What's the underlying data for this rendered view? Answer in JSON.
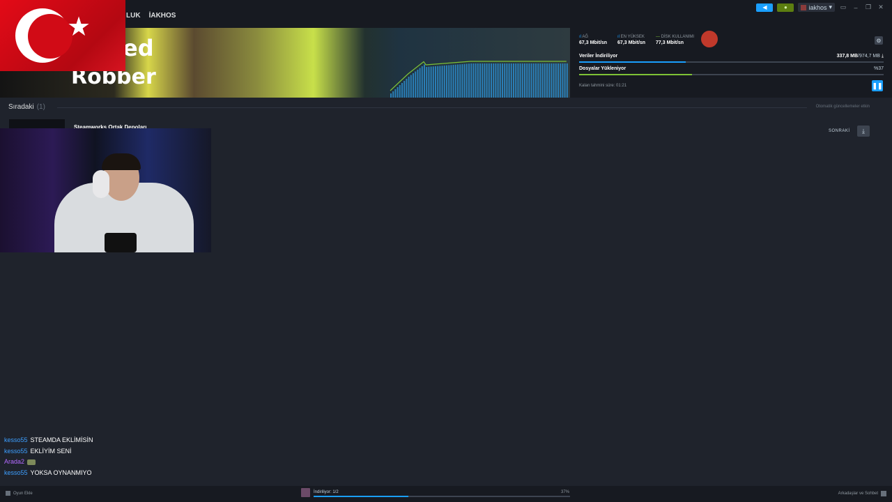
{
  "colors": {
    "accent": "#1a9fff",
    "chart_line": "#7ec236",
    "chart_bar": "#2a7fb8",
    "text_white": "#ffffff"
  },
  "menu": [
    "LUK",
    "İAKHOS"
  ],
  "window": {
    "user_name": "iakhos"
  },
  "banner": {
    "title_top": "ed",
    "title_bottom": "Robber"
  },
  "stats": {
    "network": {
      "label": "AĞ",
      "value": "67,3 Mbit/sn"
    },
    "peak": {
      "label": "EN YÜKSEK",
      "value": "67,3 Mbit/sn"
    },
    "disk": {
      "label": "DİSK KULLANIMI",
      "value": "77,3 Mbit/sn"
    }
  },
  "progress": {
    "downloading_label": "Veriler İndiriliyor",
    "downloaded": "337,8 MB",
    "total": "/974,7 MB",
    "downloading_fraction": 0.35,
    "uploading_label": "Dosyalar Yükleniyor",
    "uploading_percent_text": "%37",
    "uploading_fraction": 0.37,
    "eta": "Kalan tahmini süre: 01:21"
  },
  "queue": {
    "title": "Sıradaki",
    "count": "(1)",
    "auto_updates": "Otomatik güncellemeler etkin",
    "item_title": "Steamworks Ortak Depoları",
    "next_label": "SONRAKİ"
  },
  "chat": [
    {
      "user": "kesso55",
      "color": "#3d9fff",
      "text": "STEAMDA EKLİMİSİN"
    },
    {
      "user": "kesso55",
      "color": "#3d9fff",
      "text": "EKLİYİM SENİ"
    },
    {
      "user": "Arada2",
      "color": "#b36bff",
      "text": ""
    },
    {
      "user": "kesso55",
      "color": "#3d9fff",
      "text": "YOKSA OYNANMIYO"
    }
  ],
  "bottom": {
    "add_game": "Oyun Ekle",
    "downloading": "İndiriliyor: 1/2",
    "percent": "37%",
    "fraction": 0.37,
    "friends": "Arkadaşlar ve Sohbet"
  }
}
